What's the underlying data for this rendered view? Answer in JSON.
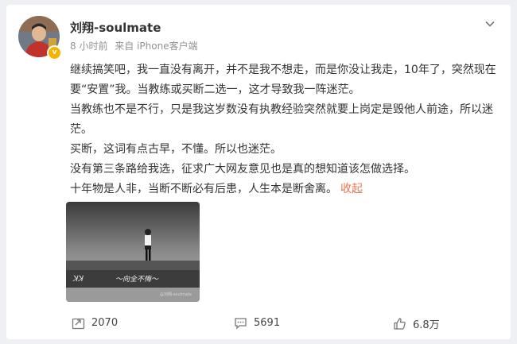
{
  "post": {
    "author": {
      "name": "刘翔-soulmate",
      "verified_badge": "v"
    },
    "time": "8 小时前",
    "source": "来自 iPhone客户端",
    "paragraphs": [
      "继续搞笑吧，我一直没有离开，并不是我不想走，而是你没让我走，10年了，突然现在要“安置”我。当教练或买断二选一，这才导致我一阵迷茫。",
      "当教练也不是不行，只是我这岁数没有执教经验突然就要上岗定是毁他人前途，所以迷茫。",
      "买断，这词有点古早，不懂。所以也迷茫。",
      "没有第三条路给我选，征求广大网友意见也是真的想知道该怎做选择。",
      "十年物是人非，当断不断必有后患，人生本是断舍离。"
    ],
    "collapse_label": "收起",
    "image": {
      "watermark": "@刘翔-soulmate"
    }
  },
  "actions": {
    "repost_count": "2070",
    "comment_count": "5691",
    "like_count": "6.8万"
  },
  "colors": {
    "accent": "#eb7350",
    "badge": "#f6b400",
    "text": "#333333",
    "meta": "#939393"
  }
}
